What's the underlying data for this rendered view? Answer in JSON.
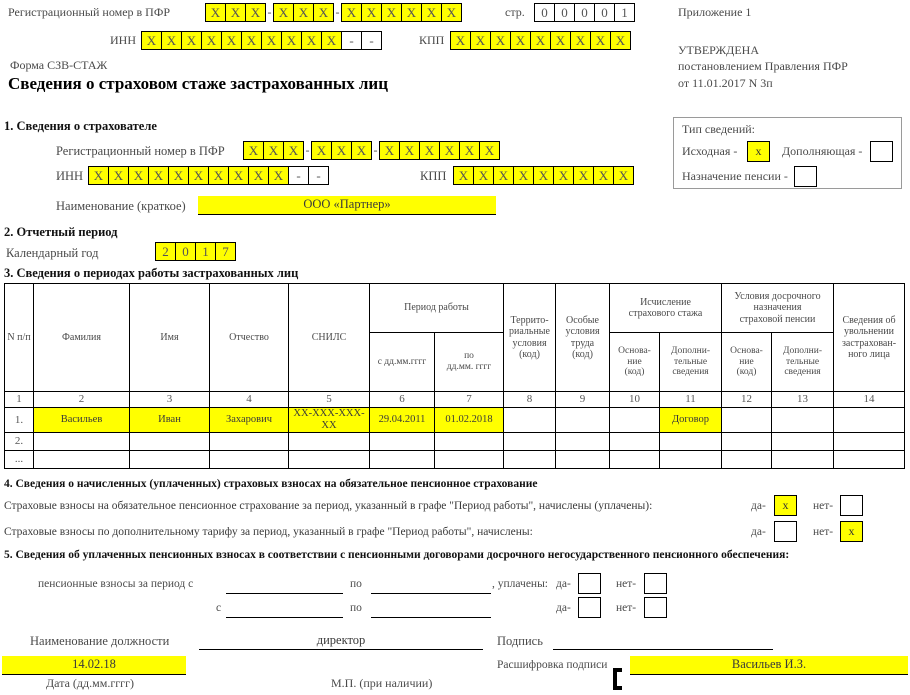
{
  "header": {
    "reg_number_label": "Регистрационный номер в ПФР",
    "reg_groups": [
      [
        "X",
        "X",
        "X"
      ],
      [
        "X",
        "X",
        "X"
      ],
      [
        "X",
        "X",
        "X",
        "X",
        "X",
        "X"
      ]
    ],
    "page_label": "стр.",
    "page_cells": [
      "0",
      "0",
      "0",
      "0",
      "1"
    ],
    "inn_label": "ИНН",
    "inn_cells": [
      "X",
      "X",
      "X",
      "X",
      "X",
      "X",
      "X",
      "X",
      "X",
      "X"
    ],
    "inn_tail": [
      "-",
      "-"
    ],
    "kpp_label": "КПП",
    "kpp_cells": [
      "X",
      "X",
      "X",
      "X",
      "X",
      "X",
      "X",
      "X",
      "X"
    ],
    "form_name": "Форма СЗВ-СТАЖ",
    "title": "Сведения о страховом стаже застрахованных лиц",
    "appendix": "Приложение 1",
    "approved": "УТВЕРЖДЕНА",
    "approved_by": "постановлением Правления ПФР",
    "approved_date": "от 11.01.2017 N 3п"
  },
  "info_type": {
    "caption": "Тип сведений:",
    "initial_label": "Исходная -",
    "initial_value": "x",
    "supplementary_label": "Дополняющая -",
    "supplementary_value": "",
    "pension_label": "Назначение пенсии -",
    "pension_value": ""
  },
  "section1": {
    "heading": "1. Сведения о страхователе",
    "reg_number_label": "Регистрационный номер в ПФР",
    "reg_groups": [
      [
        "X",
        "X",
        "X"
      ],
      [
        "X",
        "X",
        "X"
      ],
      [
        "X",
        "X",
        "X",
        "X",
        "X",
        "X"
      ]
    ],
    "inn_label": "ИНН",
    "inn_cells": [
      "X",
      "X",
      "X",
      "X",
      "X",
      "X",
      "X",
      "X",
      "X",
      "X"
    ],
    "inn_tail": [
      "-",
      "-"
    ],
    "kpp_label": "КПП",
    "kpp_cells": [
      "X",
      "X",
      "X",
      "X",
      "X",
      "X",
      "X",
      "X",
      "X"
    ],
    "name_label": "Наименование (краткое)",
    "name_value": "ООО «Партнер»"
  },
  "section2": {
    "heading": "2. Отчетный период",
    "year_label": "Календарный год",
    "year_cells": [
      "2",
      "0",
      "1",
      "7"
    ]
  },
  "section3": {
    "heading": "3. Сведения о периодах работы застрахованных лиц",
    "columns": {
      "np": "N п/п",
      "surname": "Фамилия",
      "firstname": "Имя",
      "patronymic": "Отчество",
      "snils": "СНИЛС",
      "work_period": "Период работы",
      "date_from": "с дд.мм.гггг",
      "date_to": "по\nдд.мм. гггг",
      "territorial": "Террито-\nриальные\nусловия\n(код)",
      "special": "Особые\nусловия\nтруда\n(код)",
      "calc_group": "Исчисление\nстрахового стажа",
      "calc_basis": "Основа-\nние\n(код)",
      "calc_extra": "Дополни-\nтельные\nсведения",
      "early_group": "Условия досрочного\nназначения\nстраховой пенсии",
      "early_basis": "Основа-\nние\n(код)",
      "early_extra": "Дополни-\nтельные\nсведения",
      "dismissal": "Сведения об\nувольнении\nзастрахован-\nного лица"
    },
    "numbers": [
      "1",
      "2",
      "3",
      "4",
      "5",
      "6",
      "7",
      "8",
      "9",
      "10",
      "11",
      "12",
      "13",
      "14"
    ],
    "rows": [
      {
        "n": "1.",
        "surname": "Васильев",
        "firstname": "Иван",
        "patronymic": "Захарович",
        "snils": "XX-XXX-XXX-XX",
        "date_from": "29.04.2011",
        "date_to": "01.02.2018",
        "territorial": "",
        "special": "",
        "calc_basis": "",
        "calc_extra": "Договор",
        "early_basis": "",
        "early_extra": "",
        "dismissal": "",
        "highlight": true
      },
      {
        "n": "2.",
        "surname": "",
        "firstname": "",
        "patronymic": "",
        "snils": "",
        "date_from": "",
        "date_to": "",
        "territorial": "",
        "special": "",
        "calc_basis": "",
        "calc_extra": "",
        "early_basis": "",
        "early_extra": "",
        "dismissal": "",
        "highlight": false
      },
      {
        "n": "...",
        "surname": "",
        "firstname": "",
        "patronymic": "",
        "snils": "",
        "date_from": "",
        "date_to": "",
        "territorial": "",
        "special": "",
        "calc_basis": "",
        "calc_extra": "",
        "early_basis": "",
        "early_extra": "",
        "dismissal": "",
        "highlight": false
      }
    ]
  },
  "section4": {
    "heading": "4. Сведения о начисленных (уплаченных) страховых взносах на обязательное пенсионное страхование",
    "line1": "Страховые взносы на обязательное пенсионное страхование за период, указанный в графе \"Период работы\", начислены (уплачены):",
    "line1_yes_label": "да-",
    "line1_yes_value": "x",
    "line1_no_label": "нет-",
    "line1_no_value": "",
    "line2": "Страховые взносы по дополнительному тарифу за период, указанный в графе \"Период работы\", начислены:",
    "line2_yes_label": "да-",
    "line2_yes_value": "",
    "line2_no_label": "нет-",
    "line2_no_value": "x"
  },
  "section5": {
    "heading": "5. Сведения об уплаченных пенсионных взносах в соответствии с пенсионными договорами досрочного негосударственного пенсионного обеспечения:",
    "row1_prefix": "пенсионные взносы за период с",
    "row1_mid": "по",
    "row1_suffix": ", уплачены:",
    "row1_yes": "да-",
    "row1_no": "нет-",
    "row2_prefix": "с",
    "row2_mid": "по",
    "row2_yes": "да-",
    "row2_no": "нет-"
  },
  "footer": {
    "position_label": "Наименование должности",
    "position_value": "директор",
    "signature_label": "Подпись",
    "signature_value": "",
    "date_value": "14.02.18",
    "date_label": "Дата (дд.мм.гггг)",
    "stamp_label": "М.П. (при наличии)",
    "decoding_label": "Расшифровка подписи",
    "decoding_value": "Васильев И.З."
  }
}
